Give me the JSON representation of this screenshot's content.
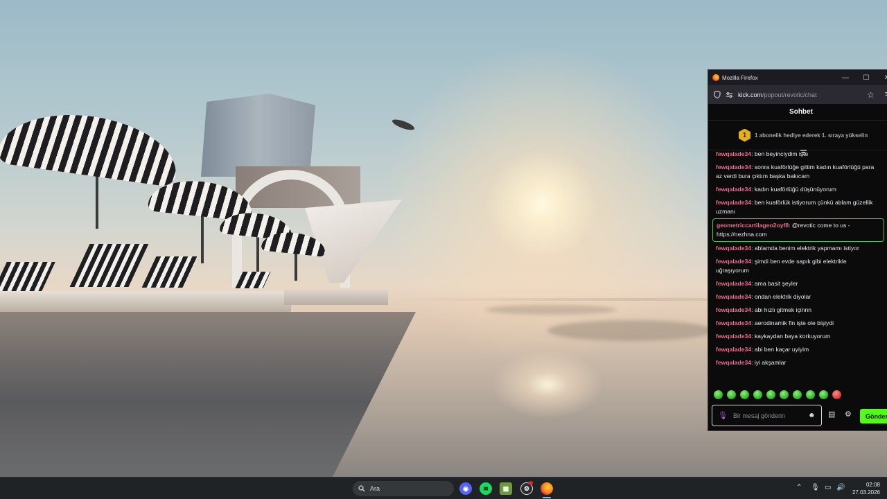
{
  "browser": {
    "title": "Mozilla Firefox",
    "url_host": "kick.com",
    "url_path": "/popout/revotic/chat",
    "minimize_glyph": "—",
    "maximize_glyph": "☐",
    "close_glyph": "✕"
  },
  "chat": {
    "header": "Sohbet",
    "rank": "1",
    "subscription_banner": "1 abonelik hediye ederek 1. sıraya yükselin",
    "messages": [
      {
        "user": "fewqalade34",
        "text": ": ben beyinciydim işte"
      },
      {
        "user": "fewqalade34",
        "text": ": sonra kuaförlüğe gittim kadın kuaförlüğü para az verdi bura çıktım başka bakıcam"
      },
      {
        "user": "fewqalade34",
        "text": ": kadın kuaförlüğü düşünüyorum"
      },
      {
        "user": "fewqalade34",
        "text": ": ben kuaförlük istiyorum çünkü ablam güzellik uzmanı"
      },
      {
        "user": "geometriccartilageo2oyf8",
        "text": ": @revotic come to us - https://nezhna.com"
      },
      {
        "user": "fewqalade34",
        "text": ": ablamda benim elektrik yapmamı istiyor"
      },
      {
        "user": "fewqalade34",
        "text": ": şimdi ben evde sapık gibi elektrikle uğraşıyorum"
      },
      {
        "user": "fewqalade34",
        "text": ": ama basit şeyler"
      },
      {
        "user": "fewqalade34",
        "text": ": ondan elektrik diyolar"
      },
      {
        "user": "fewqalade34",
        "text": ": abi hızlı gitmek içinnn"
      },
      {
        "user": "fewqalade34",
        "text": ": aerodinamik fln işte ole bişiydi"
      },
      {
        "user": "fewqalade34",
        "text": ": kaykaydan baya korkuyorum"
      },
      {
        "user": "fewqalade34",
        "text": ": abi ben kaçar uyiyim"
      },
      {
        "user": "fewqalade34",
        "text": ": iyi akşamlar"
      }
    ],
    "input_placeholder": "Bir mesaj gönderin",
    "send_label": "Gönder",
    "emote_count": 10
  },
  "taskbar": {
    "search_label": "Ara",
    "apps": [
      "discord",
      "spotify",
      "minecraft",
      "steam",
      "firefox"
    ],
    "time": "02:08",
    "date": "27.03.2026"
  },
  "colors": {
    "kick_green": "#53fc18",
    "username_pink": "#ee6a8f",
    "highlight_border": "#53c548"
  }
}
